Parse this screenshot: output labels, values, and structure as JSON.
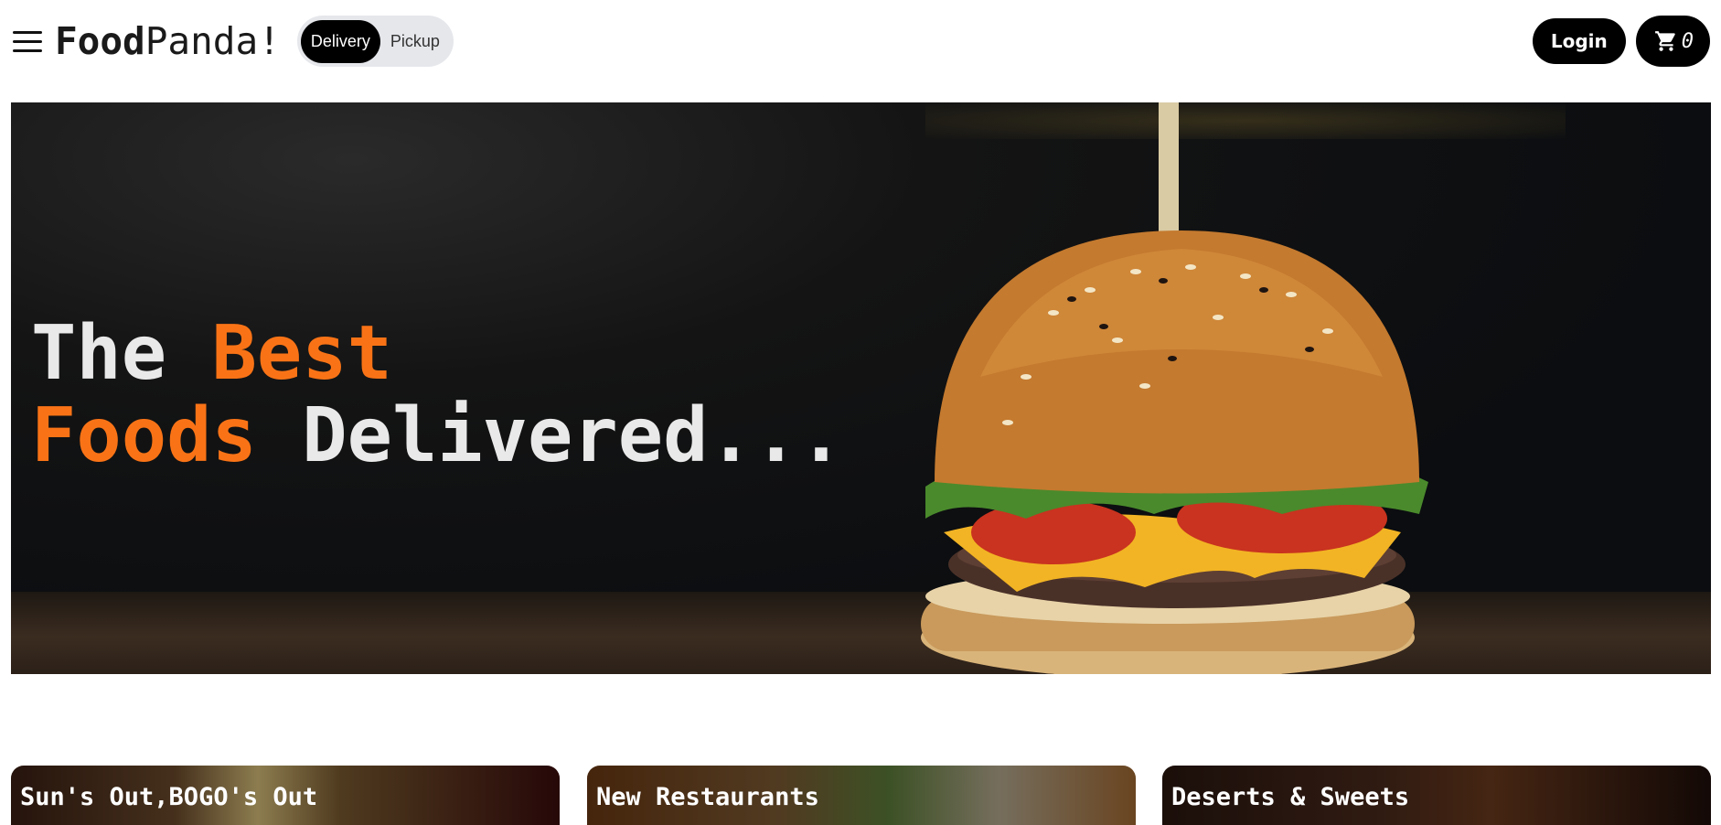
{
  "header": {
    "logo_bold": "Food",
    "logo_regular": "Panda!",
    "toggle": {
      "delivery_label": "Delivery",
      "pickup_label": "Pickup",
      "selected": "Delivery"
    },
    "login_label": "Login",
    "cart_count": "0",
    "icons": [
      "menu-icon",
      "cart-icon"
    ]
  },
  "hero": {
    "line1_plain": "The ",
    "line1_accent": "Best",
    "line2_accent": "Foods",
    "line2_plain": " Delivered...",
    "image_subject": "burger"
  },
  "categories": [
    {
      "label": "Sun's Out,BOGO's Out"
    },
    {
      "label": "New Restaurants"
    },
    {
      "label": "Deserts & Sweets"
    }
  ],
  "colors": {
    "accent": "#f97316",
    "button_bg": "#000000",
    "toggle_bg": "#e5e7eb",
    "hero_text": "#e9e9e9"
  }
}
